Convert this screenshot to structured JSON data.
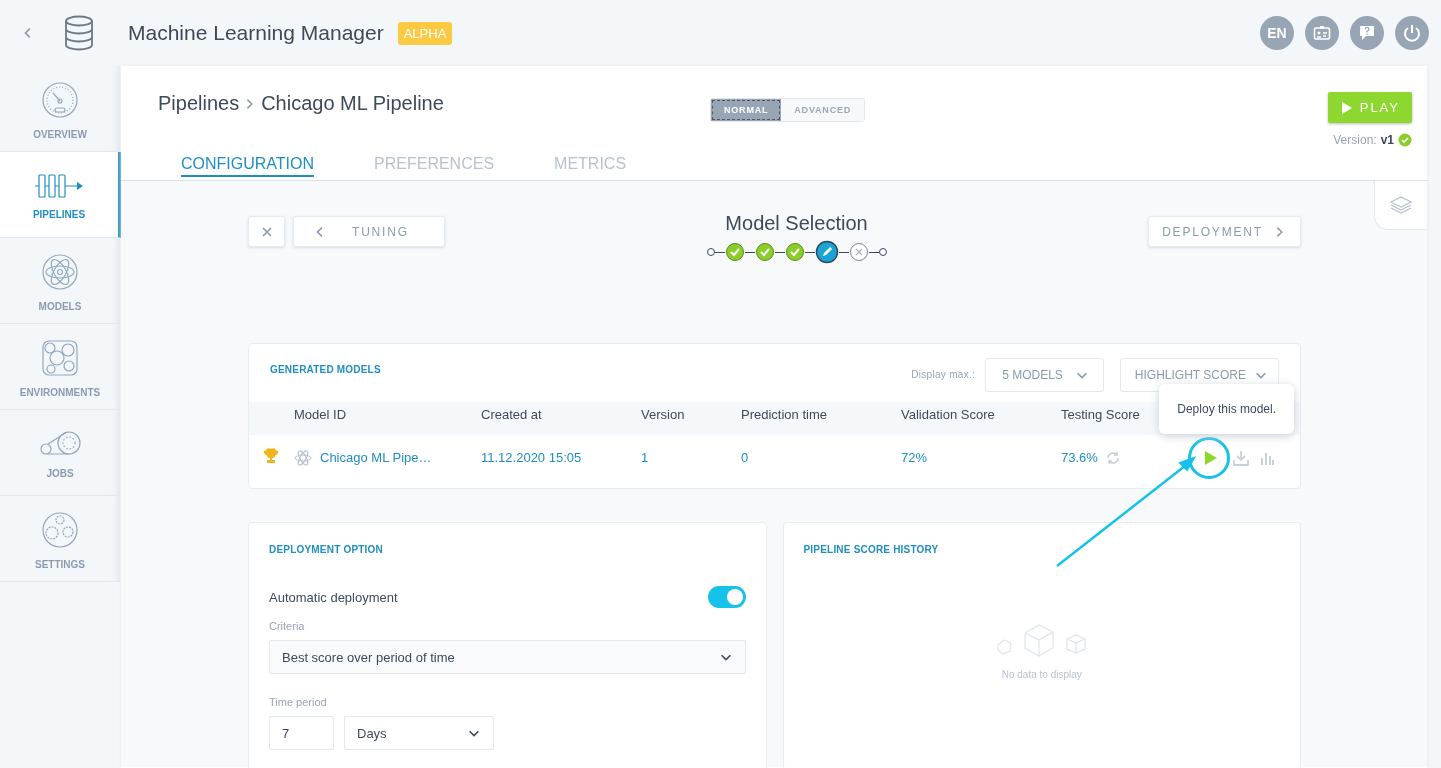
{
  "app": {
    "title": "Machine Learning Manager",
    "badge": "ALPHA"
  },
  "header_buttons": [
    {
      "kind": "language",
      "label": "EN"
    },
    {
      "kind": "id-card"
    },
    {
      "kind": "help"
    },
    {
      "kind": "power"
    }
  ],
  "sidebar": {
    "items": [
      {
        "label": "OVERVIEW",
        "kind": "gauge",
        "selected": false
      },
      {
        "label": "PIPELINES",
        "kind": "pipeline",
        "selected": true
      },
      {
        "label": "MODELS",
        "kind": "atom",
        "selected": false
      },
      {
        "label": "ENVIRONMENTS",
        "kind": "bubbles",
        "selected": false
      },
      {
        "label": "JOBS",
        "kind": "belt",
        "selected": false
      },
      {
        "label": "SETTINGS",
        "kind": "gears",
        "selected": false
      }
    ]
  },
  "breadcrumb": [
    "Pipelines",
    "Chicago ML Pipeline"
  ],
  "mode_toggle": [
    {
      "label": "NORMAL",
      "selected": true
    },
    {
      "label": "ADVANCED",
      "selected": false
    }
  ],
  "play_button": "PLAY",
  "version": {
    "label": "Version:",
    "value": "v1",
    "valid": true
  },
  "tabs": [
    {
      "label": "CONFIGURATION",
      "selected": true
    },
    {
      "label": "PREFERENCES",
      "selected": false
    },
    {
      "label": "METRICS",
      "selected": false
    }
  ],
  "wizard": {
    "back": "TUNING",
    "title": "Model Selection",
    "next": "DEPLOYMENT",
    "steps": [
      {
        "completed": true,
        "current": false
      },
      {
        "completed": true,
        "current": false
      },
      {
        "completed": true,
        "current": false
      },
      {
        "completed": false,
        "current": true
      },
      {
        "completed": false,
        "current": false
      }
    ]
  },
  "generated_models": {
    "title": "GENERATED MODELS",
    "display_max_label": "Display max.:",
    "display_max": "5 MODELS",
    "highlight": "HIGHLIGHT SCORE",
    "columns": [
      "Model ID",
      "Created at",
      "Version",
      "Prediction time",
      "Validation Score",
      "Testing Score"
    ],
    "rows": [
      {
        "best": true,
        "model_id": "Chicago ML Pipe…",
        "created_at": "11.12.2020 15:05",
        "version": "1",
        "prediction_time": "0",
        "validation_score": "72%",
        "testing_score": "73.6%"
      }
    ],
    "tooltip": "Deploy this model."
  },
  "deployment_option": {
    "title": "DEPLOYMENT OPTION",
    "auto_label": "Automatic deployment",
    "auto_on": true,
    "criteria_label": "Criteria",
    "criteria": "Best score over period of time",
    "time_period_label": "Time period",
    "time_value": "7",
    "time_unit": "Days"
  },
  "score_history": {
    "title": "PIPELINE SCORE HISTORY",
    "empty": "No data to display"
  }
}
